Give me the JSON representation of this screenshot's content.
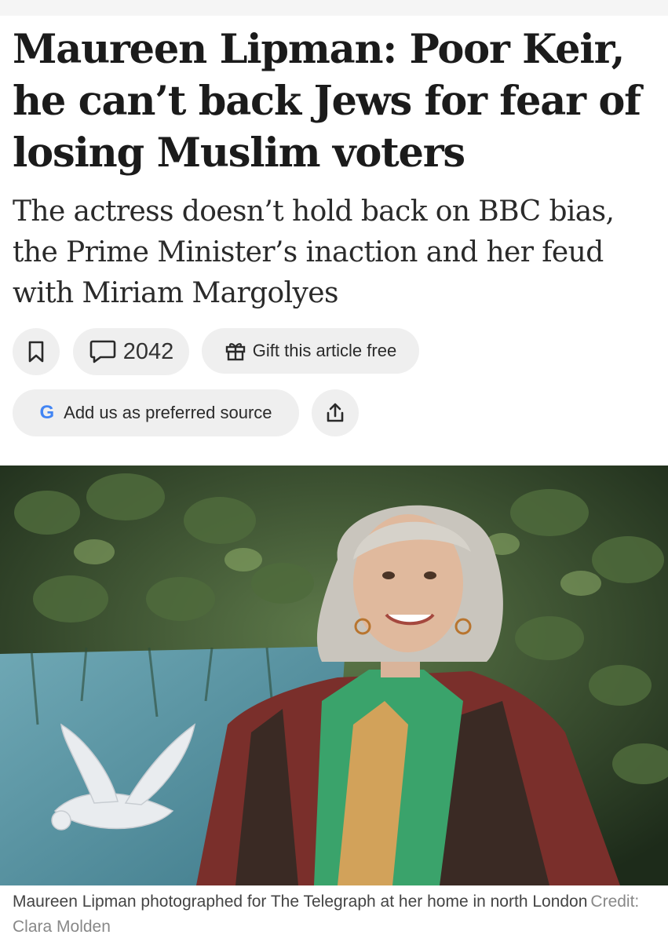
{
  "article": {
    "headline": "Maureen Lipman: Poor Keir, he can’t back Jews for fear of losing Muslim voters",
    "standfirst": "The actress doesn’t hold back on BBC bias, the Prime Minister’s inaction and her feud with Miriam Margolyes"
  },
  "actions": {
    "bookmark_icon": "bookmark-icon",
    "comment_icon": "comment-icon",
    "comment_count": "2042",
    "gift_icon": "gift-icon",
    "gift_label": "Gift this article free",
    "google_letter": "G",
    "source_label": "Add us as preferred source",
    "share_icon": "share-icon"
  },
  "image": {
    "caption": "Maureen Lipman photographed for The Telegraph at her home in north London",
    "credit": "Credit: Clara Molden"
  },
  "colors": {
    "pill_background": "#efefef",
    "text": "#1a1a1a",
    "google_blue": "#4285F4",
    "google_red": "#EA4335",
    "google_yellow": "#FBBC05",
    "google_green": "#34A853"
  }
}
